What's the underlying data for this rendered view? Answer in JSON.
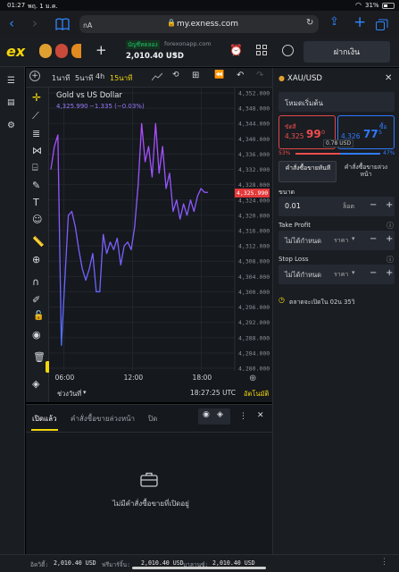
{
  "status_bar": {
    "time": "01:27",
    "date": "พฤ. 1 ม.ค.",
    "battery": "31%"
  },
  "browser": {
    "tab_label": "กA",
    "url": "my.exness.com"
  },
  "app": {
    "logo": "ex",
    "account_type": "บัญชีทดลอง",
    "server": "forexonapp.com",
    "balance": "2,010.40 USD",
    "deposit_label": "ฝากเงิน"
  },
  "chart_toolbar": {
    "timeframes": [
      "1นาที",
      "5นาที",
      "4h",
      "15นาที"
    ],
    "active": "15นาที"
  },
  "chart": {
    "title": "Gold vs US Dollar",
    "price": "4,325.990",
    "change": "−1.335 (−0.03%)",
    "current_price_tag": "4,325.990",
    "range_label": "ช่วงวันที่",
    "clock": "18:27:25 UTC",
    "auto_label": "อัตโนมัติ"
  },
  "chart_data": {
    "type": "line",
    "ylim": [
      4280,
      4352
    ],
    "y_ticks": [
      "4,352.000",
      "4,348.000",
      "4,344.000",
      "4,340.000",
      "4,336.000",
      "4,332.000",
      "4,328.000",
      "4,324.000",
      "4,320.000",
      "4,316.000",
      "4,312.000",
      "4,308.000",
      "4,304.000",
      "4,300.000",
      "4,296.000",
      "4,292.000",
      "4,288.000",
      "4,284.000",
      "4,280.000"
    ],
    "x_ticks": [
      "06:00",
      "12:00",
      "18:00"
    ],
    "series": [
      {
        "values": [
          4332,
          4338,
          4341,
          4286,
          4303,
          4320,
          4321,
          4317,
          4311,
          4306,
          4303,
          4306,
          4310,
          4300,
          4300,
          4315,
          4310,
          4313,
          4311,
          4314,
          4307,
          4312,
          4313,
          4311,
          4317,
          4328,
          4344,
          4334,
          4338,
          4330,
          4344,
          4331,
          4338,
          4327,
          4331,
          4321,
          4324,
          4319,
          4323,
          4320,
          4324,
          4321,
          4325,
          4327,
          4326,
          4326
        ]
      }
    ]
  },
  "bottom_panel": {
    "tabs": [
      "เปิดแล้ว",
      "คำสั่งซื้อขายล่วงหน้า",
      "ปิด"
    ],
    "empty_message": "ไม่มีคำสั่งซื้อขายที่เปิดอยู่"
  },
  "order_panel": {
    "symbol": "XAU/USD",
    "mode": "โหมดเริ่มต้น",
    "sell_label": "ขัดสี",
    "sell_price_main": "4,325",
    "sell_price_big": "99",
    "sell_price_small": "0",
    "buy_label": "ซื้อ",
    "buy_price_main": "4,326",
    "buy_price_big": "77",
    "buy_price_small": "5",
    "spread": "0.78 USD",
    "sell_pct": "53%",
    "buy_pct": "47%",
    "tab_instant": "คำสั่งซื้อขายทันที",
    "tab_pending": "คำสั่งซื้อขายล่วงหน้า",
    "volume_label": "ขนาด",
    "volume_value": "0.01",
    "volume_unit": "ล็อต",
    "tp_label": "Take Profit",
    "tp_value": "ไม่ได้กำหนด",
    "tp_unit": "ราคา",
    "sl_label": "Stop Loss",
    "sl_value": "ไม่ได้กำหนด",
    "sl_unit": "ราคา",
    "market_note": "ตลาดจะเปิดใน 02น 35วิ"
  },
  "footer": {
    "equity_label": "อิควิตี้:",
    "equity": "2,010.40 USD",
    "free_margin_label": "ฟรีมาร์จิ้น:",
    "free_margin": "2,010.40 USD",
    "balance_label": "บาลานซ์:",
    "balance": "2,010.40 USD"
  },
  "colors": {
    "accent_yellow": "#f5d60a",
    "line": "#7b61ff",
    "sell": "#ef4d4d",
    "buy": "#2f7bff",
    "price_tag": "#e5393a"
  }
}
